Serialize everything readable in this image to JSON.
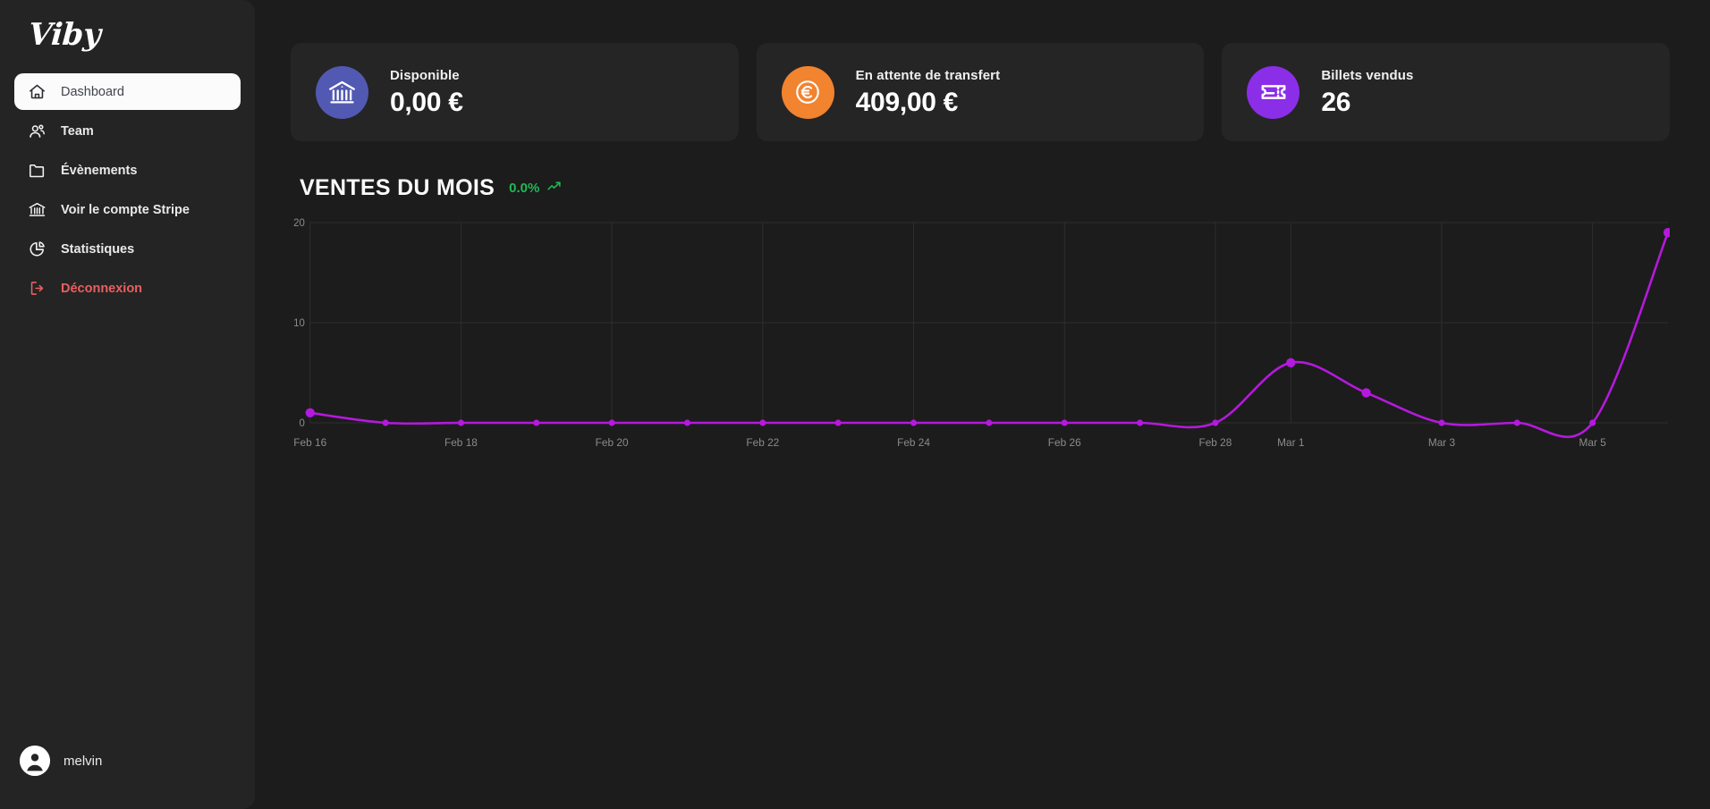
{
  "brand": {
    "name": "Viby"
  },
  "sidebar": {
    "items": [
      {
        "label": "Dashboard",
        "icon": "home-icon",
        "key": "dashboard",
        "active": true
      },
      {
        "label": "Team",
        "icon": "users-icon",
        "key": "team",
        "active": false
      },
      {
        "label": "Évènements",
        "icon": "folder-icon",
        "key": "evenements",
        "active": false
      },
      {
        "label": "Voir le compte Stripe",
        "icon": "bank-icon",
        "key": "stripe",
        "active": false
      },
      {
        "label": "Statistiques",
        "icon": "pie-chart-icon",
        "key": "statistiques",
        "active": false
      },
      {
        "label": "Déconnexion",
        "icon": "logout-icon",
        "key": "deconnexion",
        "active": false,
        "danger": true
      }
    ],
    "user": {
      "name": "melvin",
      "avatar_icon": "user-avatar-icon"
    }
  },
  "cards": [
    {
      "label": "Disponible",
      "value": "0,00 €",
      "icon": "bank-icon",
      "icon_bg": "#5259b3"
    },
    {
      "label": "En attente de transfert",
      "value": "409,00 €",
      "icon": "euro-coin-icon",
      "icon_bg": "#f2832f"
    },
    {
      "label": "Billets vendus",
      "value": "26",
      "icon": "ticket-icon",
      "icon_bg": "#8b2ee8"
    }
  ],
  "chart_header": {
    "title": "VENTES DU MOIS",
    "delta": "0.0%",
    "delta_icon": "trending-up-icon",
    "delta_color": "#1fb955"
  },
  "chart_data": {
    "type": "line",
    "title": "VENTES DU MOIS",
    "xlabel": "",
    "ylabel": "",
    "ylim": [
      0,
      20
    ],
    "yticks": [
      0,
      10,
      20
    ],
    "grid": true,
    "legend": false,
    "line_color": "#b519dd",
    "categories": [
      "Feb 16",
      "Feb 17",
      "Feb 18",
      "Feb 19",
      "Feb 20",
      "Feb 21",
      "Feb 22",
      "Feb 23",
      "Feb 24",
      "Feb 25",
      "Feb 26",
      "Feb 27",
      "Feb 28",
      "Mar 1",
      "Mar 2",
      "Mar 3",
      "Mar 4",
      "Mar 5",
      "Mar 6"
    ],
    "tick_labels": [
      "Feb 16",
      "Feb 18",
      "Feb 20",
      "Feb 22",
      "Feb 24",
      "Feb 26",
      "Feb 28",
      "Mar 1",
      "Mar 3",
      "Mar 5"
    ],
    "values": [
      1,
      0,
      0,
      0,
      0,
      0,
      0,
      0,
      0,
      0,
      0,
      0,
      0,
      6,
      3,
      0,
      0,
      0,
      19
    ],
    "series": [
      {
        "name": "Ventes",
        "values": [
          1,
          0,
          0,
          0,
          0,
          0,
          0,
          0,
          0,
          0,
          0,
          0,
          0,
          6,
          3,
          0,
          0,
          0,
          19
        ]
      }
    ]
  }
}
